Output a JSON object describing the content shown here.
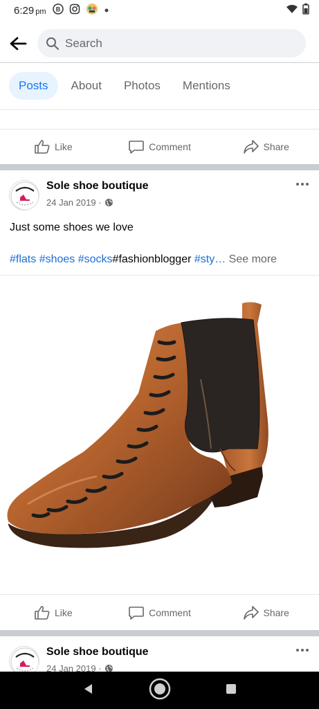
{
  "status_bar": {
    "time": "6:29",
    "ampm": "pm"
  },
  "search": {
    "placeholder": "Search"
  },
  "tabs": [
    {
      "label": "Posts"
    },
    {
      "label": "About"
    },
    {
      "label": "Photos"
    },
    {
      "label": "Mentions"
    }
  ],
  "actions": {
    "like": "Like",
    "comment": "Comment",
    "share": "Share"
  },
  "posts": [
    {
      "author": "Sole shoe boutique",
      "date": "24 Jan 2019 ·",
      "text": "Just some shoes we love",
      "hashtags": {
        "t1": "#flats",
        "t2": "#shoes",
        "t3": "#socks",
        "plain": "#fashionblogger",
        "t4": "#sty…",
        "see_more": "See more"
      }
    },
    {
      "author": "Sole shoe boutique",
      "date": "24 Jan 2019 ·"
    }
  ],
  "colors": {
    "accent": "#1877f2",
    "tab_active_bg": "#e7f3ff",
    "hashtag": "#1a6ed8",
    "secondary_text": "#65676b",
    "separator": "#c9ccd1",
    "boot": "#b8652f"
  }
}
